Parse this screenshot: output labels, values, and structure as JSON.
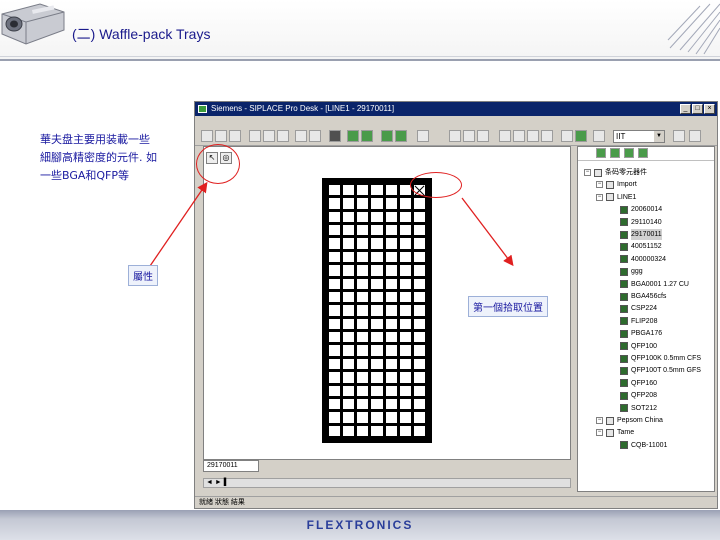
{
  "slide": {
    "title": "(二) Waffle-pack Trays",
    "description_lines": [
      "華夫盘主要用装載一些",
      "細腳高精密度的元件. 如",
      "一些BGA和QFP等"
    ],
    "callout_property": "屬性",
    "callout_first_pick": "第一個拾取位置",
    "brand": "FLEXTRONICS"
  },
  "app": {
    "title": "Siemens - SIPLACE Pro Desk - [LINE1 - 29170011]",
    "combo_value": "IIT",
    "canvas_tab": "29170011",
    "hscroll_text": "◄ ► ▌",
    "status_text": "就緒 狀態 結果"
  },
  "tree": {
    "items": [
      {
        "label": "条码零元器件",
        "level": 0,
        "icon": "fold"
      },
      {
        "label": "Import",
        "level": 1,
        "icon": "fold"
      },
      {
        "label": "LINE1",
        "level": 1,
        "icon": "fold"
      },
      {
        "label": "20060014",
        "level": 2,
        "icon": "sq"
      },
      {
        "label": "29110140",
        "level": 2,
        "icon": "sq"
      },
      {
        "label": "29170011",
        "level": 2,
        "icon": "sq",
        "selected": true
      },
      {
        "label": "40051152",
        "level": 2,
        "icon": "sq"
      },
      {
        "label": "400000324",
        "level": 2,
        "icon": "sq"
      },
      {
        "label": "ggg",
        "level": 2,
        "icon": "sq"
      },
      {
        "label": "BGA0001 1.27 CU",
        "level": 2,
        "icon": "sq"
      },
      {
        "label": "BGA456cfs",
        "level": 2,
        "icon": "sq"
      },
      {
        "label": "CSP224",
        "level": 2,
        "icon": "sq"
      },
      {
        "label": "FLIP208",
        "level": 2,
        "icon": "sq"
      },
      {
        "label": "PBGA176",
        "level": 2,
        "icon": "sq"
      },
      {
        "label": "QFP100",
        "level": 2,
        "icon": "sq"
      },
      {
        "label": "QFP100K 0.5mm CFS",
        "level": 2,
        "icon": "sq"
      },
      {
        "label": "QFP100T 0.5mm GFS",
        "level": 2,
        "icon": "sq"
      },
      {
        "label": "QFP160",
        "level": 2,
        "icon": "sq"
      },
      {
        "label": "QFP208",
        "level": 2,
        "icon": "sq"
      },
      {
        "label": "SOT212",
        "level": 2,
        "icon": "sq"
      },
      {
        "label": "Pepsom China",
        "level": 1,
        "icon": "fold"
      },
      {
        "label": "Tame",
        "level": 1,
        "icon": "fold"
      },
      {
        "label": "CQB-11001",
        "level": 2,
        "icon": "sq"
      }
    ]
  },
  "tray": {
    "columns": 7,
    "rows": 19,
    "first_pick": {
      "row": 1,
      "column": 7
    }
  },
  "colors": {
    "annotation_red": "#e02020",
    "title_blue": "#1a1a8c",
    "brand_blue": "#2a3e9a"
  }
}
